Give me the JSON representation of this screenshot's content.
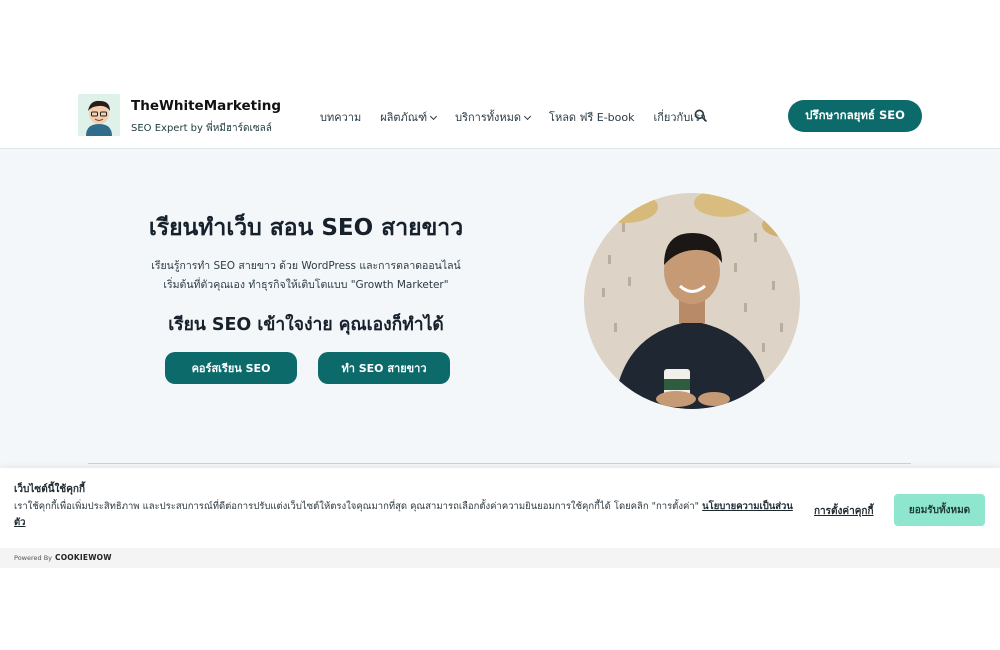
{
  "header": {
    "brand_name": "TheWhiteMarketing",
    "brand_tagline": "SEO Expert by พี่หมีฮาร์ดเซลล์",
    "nav": [
      {
        "label": "บทความ",
        "dropdown": false
      },
      {
        "label": "ผลิตภัณฑ์",
        "dropdown": true
      },
      {
        "label": "บริการทั้งหมด",
        "dropdown": true
      },
      {
        "label": "โหลด ฟรี E-book",
        "dropdown": false
      },
      {
        "label": "เกี่ยวกับเรา",
        "dropdown": false
      }
    ],
    "cta_label": "ปรึกษากลยุทธ์ SEO"
  },
  "hero": {
    "title": "เรียนทำเว็บ สอน SEO สายขาว",
    "desc_line1": "เรียนรู้การทำ SEO สายขาว ด้วย WordPress และการตลาดออนไลน์",
    "desc_line2": "เริ่มต้นที่ตัวคุณเอง ทำธุรกิจให้เติบโตแบบ \"Growth Marketer\"",
    "subtitle": "เรียน SEO เข้าใจง่าย คุณเองก็ทำได้",
    "btn_course": "คอร์สเรียน SEO",
    "btn_seo": "ทำ SEO สายขาว"
  },
  "cookie": {
    "title": "เว็บไซต์นี้ใช้คุกกี้",
    "text": "เราใช้คุกกี้เพื่อเพิ่มประสิทธิภาพ และประสบการณ์ที่ดีต่อการปรับแต่งเว็บไซต์ให้ตรงใจคุณมากที่สุด คุณสามารถเลือกตั้งค่าความยินยอมการใช้คุกกี้ได้ โดยคลิก \"การตั้งค่า\"",
    "policy_link": "นโยบายความเป็นส่วนตัว",
    "settings_link": "การตั้งค่าคุกกี้",
    "accept_all": "ยอมรับทั้งหมด",
    "powered_by": "Powered By",
    "powered_brand": "COOKIEWOW"
  },
  "colors": {
    "primary": "#0c6a6b",
    "hero_bg": "#f4f7f9",
    "accept_bg": "#8de6cd"
  },
  "icons": {
    "search": "search-icon",
    "dropdown": "chevron-down-icon"
  }
}
